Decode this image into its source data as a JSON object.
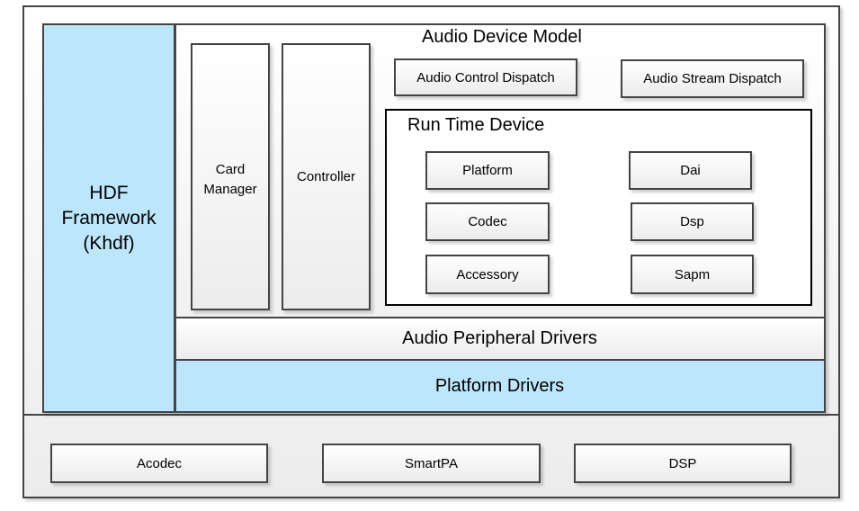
{
  "diagram": {
    "hdf_framework": {
      "label_line1": "HDF",
      "label_line2": "Framework",
      "label_line3": "(Khdf)"
    },
    "card_manager": {
      "label_line1": "Card",
      "label_line2": "Manager"
    },
    "controller": {
      "label": "Controller"
    },
    "audio_device_model": {
      "title": "Audio Device Model",
      "dispatch": [
        {
          "label": "Audio Control Dispatch"
        },
        {
          "label": "Audio Stream Dispatch"
        }
      ]
    },
    "run_time_device": {
      "title": "Run Time Device",
      "components": [
        {
          "label": "Platform"
        },
        {
          "label": "Dai"
        },
        {
          "label": "Codec"
        },
        {
          "label": "Dsp"
        },
        {
          "label": "Accessory"
        },
        {
          "label": "Sapm"
        }
      ]
    },
    "audio_peripheral_drivers": {
      "label": "Audio Peripheral Drivers"
    },
    "platform_drivers": {
      "label": "Platform Drivers"
    },
    "hardware": [
      {
        "label": "Acodec"
      },
      {
        "label": "SmartPA"
      },
      {
        "label": "DSP"
      }
    ],
    "colors": {
      "framework_blue": "#bde6fb",
      "border": "#444444"
    }
  }
}
